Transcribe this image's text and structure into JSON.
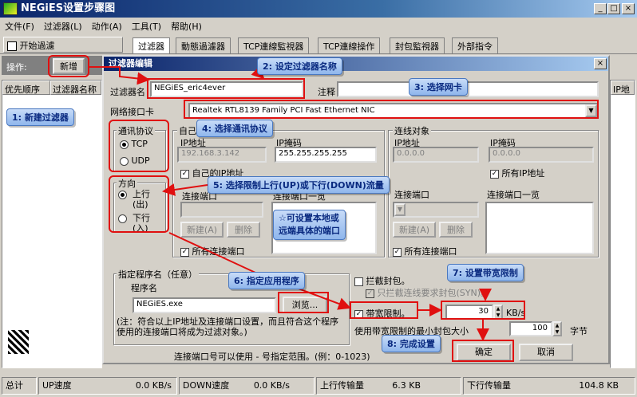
{
  "window": {
    "title": "NEGiES设置步骤图"
  },
  "menu": [
    "文件(F)",
    "过滤器(L)",
    "动作(A)",
    "工具(T)",
    "帮助(H)"
  ],
  "toolbar": {
    "start": "开始過濾"
  },
  "tabs": [
    "过滤器",
    "動態過濾器",
    "TCP連線監視器",
    "TCP連線操作",
    "封包監視器",
    "外部指令"
  ],
  "left": {
    "ops_label": "操作:",
    "new_btn": "新增",
    "col1": "优先顺序",
    "col2": "过滤器名称",
    "col_ip": "IP地址"
  },
  "dialog": {
    "title": "过滤器编辑",
    "name_label": "过滤器名",
    "name_value": "NEGiES_eric4ever",
    "note_label": "注释",
    "nic_label": "网络接口卡",
    "nic_value": "Realtek RTL8139 Family PCI Fast Ethernet NIC",
    "protocol": {
      "title": "通讯协议",
      "tcp": "TCP",
      "udp": "UDP"
    },
    "direction": {
      "title": "方向",
      "up": "上行\n(出)",
      "down": "下行\n(入)"
    },
    "self": {
      "title": "自己",
      "ip_label": "IP地址",
      "ip_value": "192.168.3.142",
      "mask_label": "IP掩码",
      "mask_value": "255.255.255.255",
      "own_ip": "自己的IP地址",
      "port_label": "连接端口",
      "port_list": "连接端口一览",
      "add": "新建(A)",
      "del": "删除",
      "all_ports": "所有连接端口"
    },
    "remote": {
      "title": "连线对象",
      "ip_label": "IP地址",
      "ip_value": "0.0.0.0",
      "mask_label": "IP掩码",
      "mask_value": "0.0.0.0",
      "all_ip": "所有IP地址",
      "port_label": "连接端口",
      "port_list": "连接端口一览",
      "add": "新建(A)",
      "del": "删除",
      "all_ports": "所有连接端口"
    },
    "program": {
      "title": "指定程序名（任意）",
      "label": "程序名",
      "value": "NEGiES.exe",
      "browse": "浏览...",
      "note": "(注：符合以上IP地址及连接端口设置，而且符合这个程序使用的连接端口将成为过滤对象。)"
    },
    "intercept": "拦截封包。",
    "syn": "只拦截连线要求封包(SYN)。",
    "bw_label": "带宽限制。",
    "bw_value": "30",
    "bw_unit": "KB/s",
    "min_label": "使用带宽限制的最小封包大小",
    "min_value": "100",
    "min_unit": "字节",
    "ok": "确定",
    "cancel": "取消",
    "port_hint": "连接端口号可以使用 - 号指定范围。(例：0-1023)"
  },
  "callouts": {
    "c1": "1: 新建过滤器",
    "c2": "2: 设定过滤器名称",
    "c3": "3: 选择网卡",
    "c4": "4: 选择通讯协议",
    "c5": "5: 选择限制上行(UP)或下行(DOWN)流量",
    "c_star1": "☆可设置本地或",
    "c_star2": "远端具体的端口",
    "c6": "6: 指定应用程序",
    "c7": "7: 设置带宽限制",
    "c8": "8: 完成设置"
  },
  "statusbar": {
    "total": "总计",
    "up": "UP速度",
    "up_val": "0.0 KB/s",
    "down": "DOWN速度",
    "down_val": "0.0 KB/s",
    "upload": "上行传输量",
    "upload_val": "6.3 KB",
    "download": "下行传输量",
    "download_val": "104.8 KB"
  }
}
